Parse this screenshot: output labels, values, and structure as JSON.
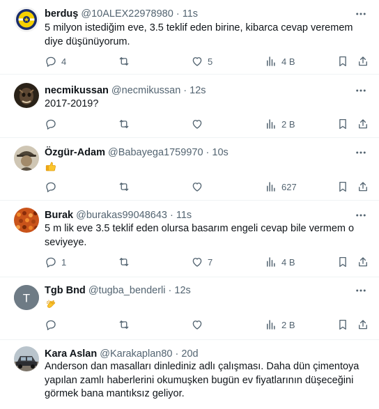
{
  "tweets": [
    {
      "name": "berduş",
      "handle": "@10ALEX22978980",
      "time": "11s",
      "text": "5 milyon istediğim eve, 3.5 teklif eden birine, kibarca cevap veremem diye düşünüyorum.",
      "replies": "4",
      "reposts": "",
      "likes": "5",
      "views": "4 B",
      "avatar": "fenerbahce-crest"
    },
    {
      "name": "necmikussan",
      "handle": "@necmikussan",
      "time": "12s",
      "text": "2017-2019?",
      "replies": "",
      "reposts": "",
      "likes": "",
      "views": "2 B",
      "avatar": "dark-portrait"
    },
    {
      "name": "Özgür-Adam",
      "handle": "@Babayega1759970",
      "time": "10s",
      "emoji": "thumbs-up",
      "replies": "",
      "reposts": "",
      "likes": "",
      "views": "627",
      "avatar": "hat-portrait"
    },
    {
      "name": "Burak",
      "handle": "@burakas99048643",
      "time": "11s",
      "text": "5 m lik eve 3.5 teklif eden olursa basarım engeli cevap bile vermem o seviyeye.",
      "replies": "1",
      "reposts": "",
      "likes": "7",
      "views": "4 B",
      "avatar": "orange-crowd"
    },
    {
      "name": "Tgb Bnd",
      "handle": "@tugba_benderli",
      "time": "12s",
      "emoji": "clapping-hands",
      "replies": "",
      "reposts": "",
      "likes": "",
      "views": "2 B",
      "avatar": "letter-T",
      "avatar_letter": "T"
    },
    {
      "name": "Kara Aslan",
      "handle": "@Karakaplan80",
      "time": "20d",
      "text": "Anderson dan masalları dinlediniz adlı çalışması. Daha dün çimentoya yapılan zamlı haberlerini okumuşken bugün ev fiyatlarının düşeceğini görmek bana mantıksız geliyor.",
      "avatar": "car-photo"
    }
  ],
  "dot": "·",
  "colors": {
    "text": "#0f1419",
    "muted": "#536471",
    "divider": "#eff3f4"
  },
  "icons": [
    "more-icon",
    "reply-icon",
    "repost-icon",
    "like-icon",
    "views-icon",
    "bookmark-icon",
    "share-icon"
  ]
}
